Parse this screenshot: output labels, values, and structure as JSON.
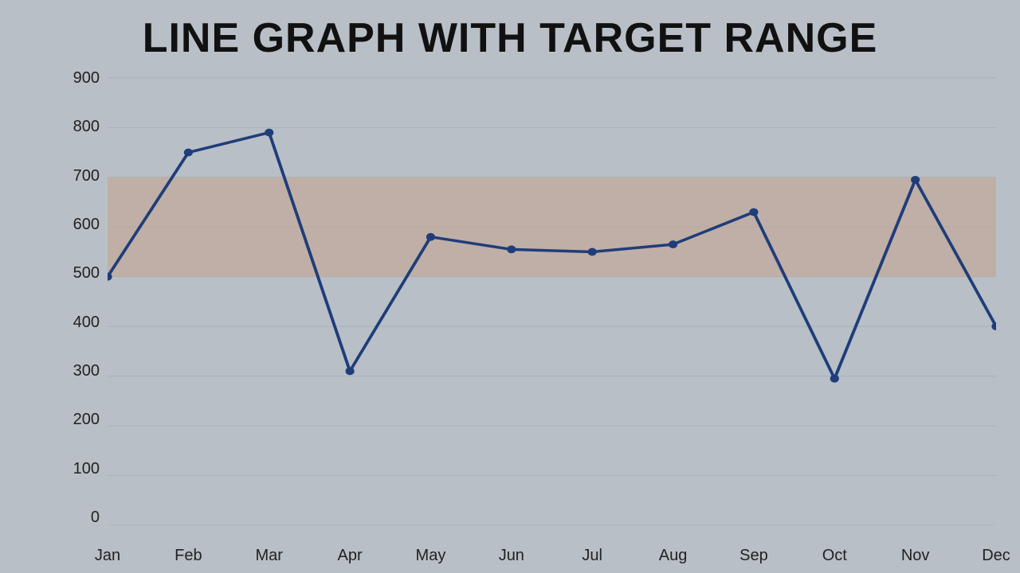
{
  "title": "LINE GRAPH WITH TARGET RANGE",
  "yAxis": {
    "labels": [
      "900",
      "800",
      "700",
      "600",
      "500",
      "400",
      "300",
      "200",
      "100",
      "0"
    ]
  },
  "xAxis": {
    "labels": [
      "Jan",
      "Feb",
      "Mar",
      "Apr",
      "May",
      "Jun",
      "Jul",
      "Aug",
      "Sep",
      "Oct",
      "Nov",
      "Dec"
    ]
  },
  "targetRange": {
    "min": 500,
    "max": 700
  },
  "dataPoints": [
    500,
    750,
    790,
    310,
    580,
    555,
    550,
    565,
    630,
    295,
    695,
    400
  ],
  "colors": {
    "background": "#b8bfc6",
    "targetFill": "#c2a898",
    "targetFillOpacity": 0.7,
    "line": "#1f3d7a",
    "gridLine": "#a8b0b8"
  }
}
